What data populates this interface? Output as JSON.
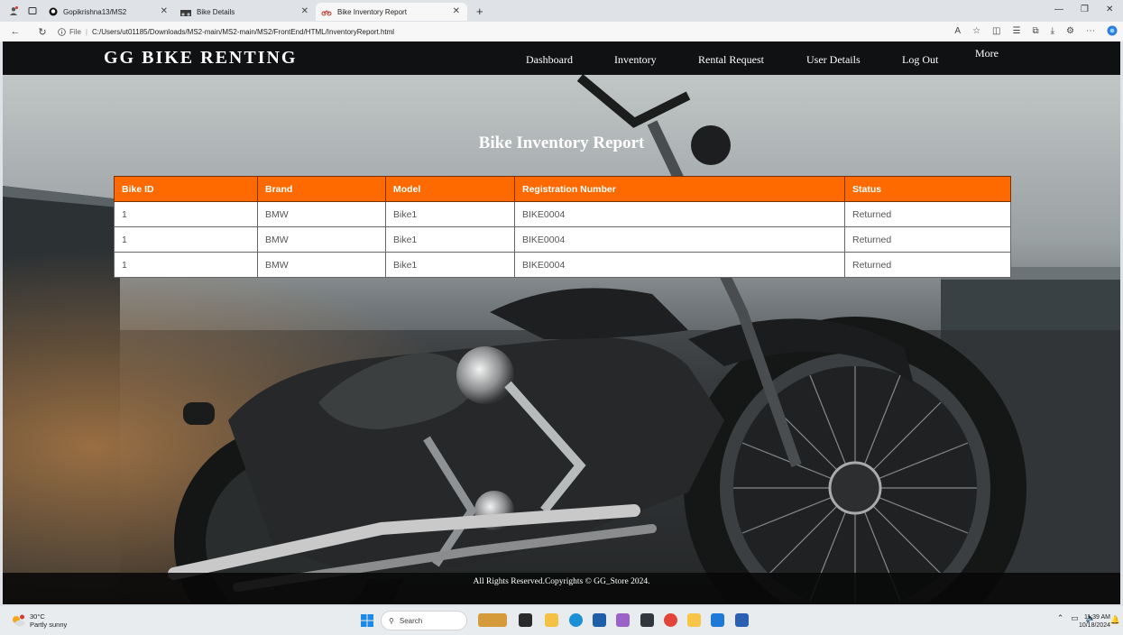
{
  "browser": {
    "tabs": [
      {
        "title": "Gopikrishna13/MS2"
      },
      {
        "title": "Bike Details"
      },
      {
        "title": "Bike Inventory Report",
        "active": true
      }
    ],
    "address": {
      "file_label": "File",
      "url": "C:/Users/ut01185/Downloads/MS2-main/MS2-main/MS2/FrontEnd/HTML/InventoryReport.html"
    }
  },
  "navbar": {
    "brand": "GG BIKE RENTING",
    "links": [
      "Dashboard",
      "Inventory",
      "Rental Request",
      "User Details",
      "Log Out",
      "More"
    ]
  },
  "report": {
    "title": "Bike Inventory Report",
    "columns": [
      "Bike ID",
      "Brand",
      "Model",
      "Registration Number",
      "Status"
    ],
    "rows": [
      [
        "1",
        "BMW",
        "Bike1",
        "BIKE0004",
        "Returned"
      ],
      [
        "1",
        "BMW",
        "Bike1",
        "BIKE0004",
        "Returned"
      ],
      [
        "1",
        "BMW",
        "Bike1",
        "BIKE0004",
        "Returned"
      ]
    ]
  },
  "footer": {
    "text": "All Rights Reserved.Copyrights © GG_Store 2024."
  },
  "taskbar": {
    "weather_temp": "30°C",
    "weather_desc": "Partly sunny",
    "search_label": "Search",
    "time": "11:39 AM",
    "date": "10/18/2024"
  },
  "colors": {
    "table_header": "#ff6a00",
    "navbar_bg": "#101112"
  }
}
